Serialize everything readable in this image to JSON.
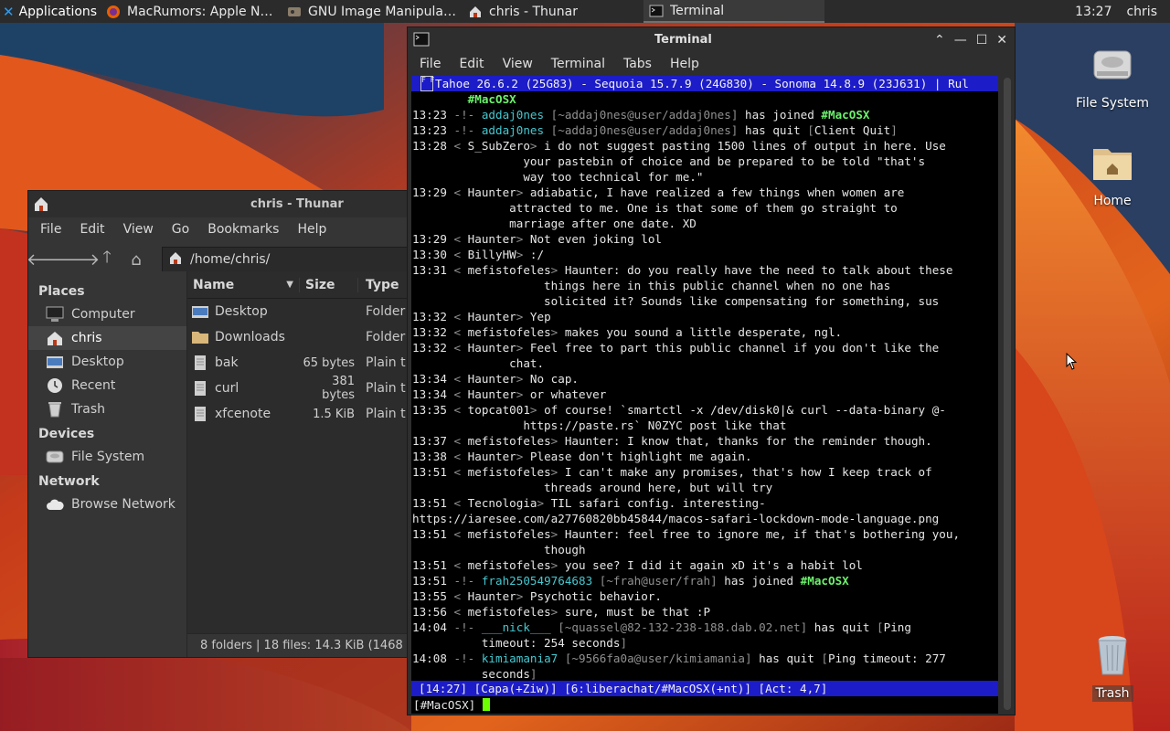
{
  "panel": {
    "applications_label": "Applications",
    "tasks": [
      {
        "title": "MacRumors: Apple New...",
        "icon": "firefox-icon"
      },
      {
        "title": "GNU Image Manipulatio...",
        "icon": "gimp-icon"
      },
      {
        "title": "chris - Thunar",
        "icon": "home-folder-icon"
      },
      {
        "title": "Terminal",
        "icon": "terminal-icon"
      }
    ],
    "clock": "13:27",
    "user": "chris"
  },
  "desktop": {
    "icons": [
      {
        "label": "File System",
        "icon": "drive-icon"
      },
      {
        "label": "Home",
        "icon": "home-folder-icon"
      },
      {
        "label": "Trash",
        "icon": "trash-icon"
      }
    ]
  },
  "thunar": {
    "title": "chris - Thunar",
    "menu": [
      "File",
      "Edit",
      "View",
      "Go",
      "Bookmarks",
      "Help"
    ],
    "path": "/home/chris/",
    "sidebar": {
      "places_heading": "Places",
      "places": [
        "Computer",
        "chris",
        "Desktop",
        "Recent",
        "Trash"
      ],
      "devices_heading": "Devices",
      "devices": [
        "File System"
      ],
      "network_heading": "Network",
      "network": [
        "Browse Network"
      ]
    },
    "columns": {
      "name": "Name",
      "size": "Size",
      "type": "Type"
    },
    "files": [
      {
        "name": "Desktop",
        "size": "",
        "type": "Folder"
      },
      {
        "name": "Downloads",
        "size": "",
        "type": "Folder"
      },
      {
        "name": "bak",
        "size": "65 bytes",
        "type": "Plain t"
      },
      {
        "name": "curl",
        "size": "381 bytes",
        "type": "Plain t"
      },
      {
        "name": "xfcenote",
        "size": "1.5 KiB",
        "type": "Plain t"
      }
    ],
    "status": "8 folders  |  18 files: 14.3 KiB (1468"
  },
  "terminal": {
    "title": "Terminal",
    "menu": [
      "File",
      "Edit",
      "View",
      "Terminal",
      "Tabs",
      "Help"
    ],
    "topic": "Tahoe 26.6.2 (25G83) - Sequoia 15.7.9 (24G830) - Sonoma 14.8.9 (23J631) | Rul",
    "lines": [
      [
        {
          "t": "        "
        },
        {
          "t": "#MacOSX",
          "c": "greenb"
        }
      ],
      [
        {
          "t": "13:23 "
        },
        {
          "t": "-!- ",
          "c": "dim"
        },
        {
          "t": "addaj0nes",
          "c": "cyan"
        },
        {
          "t": " [",
          "c": "dim"
        },
        {
          "t": "~addaj0nes@user/addaj0nes",
          "c": "dim"
        },
        {
          "t": "]",
          "c": "dim"
        },
        {
          "t": " has joined "
        },
        {
          "t": "#MacOSX",
          "c": "greenb"
        }
      ],
      [
        {
          "t": "13:23 "
        },
        {
          "t": "-!- ",
          "c": "dim"
        },
        {
          "t": "addaj0nes",
          "c": "cyan"
        },
        {
          "t": " [~addaj0nes@user/addaj0nes]",
          "c": "dim"
        },
        {
          "t": " has quit "
        },
        {
          "t": "[",
          "c": "dim"
        },
        {
          "t": "Client Quit"
        },
        {
          "t": "]",
          "c": "dim"
        }
      ],
      [
        {
          "t": "13:28 "
        },
        {
          "t": "< ",
          "c": "dim"
        },
        {
          "t": "S_SubZero"
        },
        {
          "t": "> ",
          "c": "dim"
        },
        {
          "t": "i do not suggest pasting 1500 lines of output in here. Use"
        }
      ],
      [
        {
          "t": "                your pastebin of choice and be prepared to be told \"that's"
        }
      ],
      [
        {
          "t": "                way too technical for me.\""
        }
      ],
      [
        {
          "t": "13:29 "
        },
        {
          "t": "< ",
          "c": "dim"
        },
        {
          "t": "Haunter"
        },
        {
          "t": "> ",
          "c": "dim"
        },
        {
          "t": "adiabatic, I have realized a few things when women are"
        }
      ],
      [
        {
          "t": "              attracted to me. One is that some of them go straight to"
        }
      ],
      [
        {
          "t": "              marriage after one date. XD"
        }
      ],
      [
        {
          "t": "13:29 "
        },
        {
          "t": "< ",
          "c": "dim"
        },
        {
          "t": "Haunter"
        },
        {
          "t": "> ",
          "c": "dim"
        },
        {
          "t": "Not even joking lol"
        }
      ],
      [
        {
          "t": "13:30 "
        },
        {
          "t": "< ",
          "c": "dim"
        },
        {
          "t": "BillyHW"
        },
        {
          "t": "> ",
          "c": "dim"
        },
        {
          "t": ":/"
        }
      ],
      [
        {
          "t": "13:31 "
        },
        {
          "t": "< ",
          "c": "dim"
        },
        {
          "t": "mefistofeles"
        },
        {
          "t": "> ",
          "c": "dim"
        },
        {
          "t": "Haunter: do you really have the need to talk about these"
        }
      ],
      [
        {
          "t": "                   things here in this public channel when no one has"
        }
      ],
      [
        {
          "t": "                   solicited it? Sounds like compensating for something, sus"
        }
      ],
      [
        {
          "t": "13:32 "
        },
        {
          "t": "< ",
          "c": "dim"
        },
        {
          "t": "Haunter"
        },
        {
          "t": "> ",
          "c": "dim"
        },
        {
          "t": "Yep"
        }
      ],
      [
        {
          "t": "13:32 "
        },
        {
          "t": "< ",
          "c": "dim"
        },
        {
          "t": "mefistofeles"
        },
        {
          "t": "> ",
          "c": "dim"
        },
        {
          "t": "makes you sound a little desperate, ngl."
        }
      ],
      [
        {
          "t": "13:32 "
        },
        {
          "t": "< ",
          "c": "dim"
        },
        {
          "t": "Haunter"
        },
        {
          "t": "> ",
          "c": "dim"
        },
        {
          "t": "Feel free to part this public channel if you don't like the"
        }
      ],
      [
        {
          "t": "              chat."
        }
      ],
      [
        {
          "t": "13:34 "
        },
        {
          "t": "< ",
          "c": "dim"
        },
        {
          "t": "Haunter"
        },
        {
          "t": "> ",
          "c": "dim"
        },
        {
          "t": "No cap."
        }
      ],
      [
        {
          "t": "13:34 "
        },
        {
          "t": "< ",
          "c": "dim"
        },
        {
          "t": "Haunter"
        },
        {
          "t": "> ",
          "c": "dim"
        },
        {
          "t": "or whatever"
        }
      ],
      [
        {
          "t": "13:35 "
        },
        {
          "t": "< ",
          "c": "dim"
        },
        {
          "t": "topcat001"
        },
        {
          "t": "> ",
          "c": "dim"
        },
        {
          "t": "of course! `smartctl -x /dev/disk0|& curl --data-binary @-"
        }
      ],
      [
        {
          "t": "                https://paste.rs` N0ZYC post like that"
        }
      ],
      [
        {
          "t": "13:37 "
        },
        {
          "t": "< ",
          "c": "dim"
        },
        {
          "t": "mefistofeles"
        },
        {
          "t": "> ",
          "c": "dim"
        },
        {
          "t": "Haunter: I know that, thanks for the reminder though."
        }
      ],
      [
        {
          "t": "13:38 "
        },
        {
          "t": "< ",
          "c": "dim"
        },
        {
          "t": "Haunter"
        },
        {
          "t": "> ",
          "c": "dim"
        },
        {
          "t": "Please don't highlight me again."
        }
      ],
      [
        {
          "t": "13:51 "
        },
        {
          "t": "< ",
          "c": "dim"
        },
        {
          "t": "mefistofeles"
        },
        {
          "t": "> ",
          "c": "dim"
        },
        {
          "t": "I can't make any promises, that's how I keep track of"
        }
      ],
      [
        {
          "t": "                   threads around here, but will try"
        }
      ],
      [
        {
          "t": "13:51 "
        },
        {
          "t": "< ",
          "c": "dim"
        },
        {
          "t": "Tecnologia"
        },
        {
          "t": "> ",
          "c": "dim"
        },
        {
          "t": "TIL safari config. interesting-"
        }
      ],
      [
        {
          "t": "https://iaresee.com/a27760820bb45844/macos-safari-lockdown-mode-language.png"
        }
      ],
      [
        {
          "t": "13:51 "
        },
        {
          "t": "< ",
          "c": "dim"
        },
        {
          "t": "mefistofeles"
        },
        {
          "t": "> ",
          "c": "dim"
        },
        {
          "t": "Haunter: feel free to ignore me, if that's bothering you,"
        }
      ],
      [
        {
          "t": "                   though"
        }
      ],
      [
        {
          "t": "13:51 "
        },
        {
          "t": "< ",
          "c": "dim"
        },
        {
          "t": "mefistofeles"
        },
        {
          "t": "> ",
          "c": "dim"
        },
        {
          "t": "you see? I did it again xD it's a habit lol"
        }
      ],
      [
        {
          "t": "13:51 "
        },
        {
          "t": "-!- ",
          "c": "dim"
        },
        {
          "t": "frah250549764683",
          "c": "cyan"
        },
        {
          "t": " [~frah@user/frah]",
          "c": "dim"
        },
        {
          "t": " has joined "
        },
        {
          "t": "#MacOSX",
          "c": "greenb"
        }
      ],
      [
        {
          "t": "13:55 "
        },
        {
          "t": "< ",
          "c": "dim"
        },
        {
          "t": "Haunter"
        },
        {
          "t": "> ",
          "c": "dim"
        },
        {
          "t": "Psychotic behavior."
        }
      ],
      [
        {
          "t": "13:56 "
        },
        {
          "t": "< ",
          "c": "dim"
        },
        {
          "t": "mefistofeles"
        },
        {
          "t": "> ",
          "c": "dim"
        },
        {
          "t": "sure, must be that :P"
        }
      ],
      [
        {
          "t": "14:04 "
        },
        {
          "t": "-!- ",
          "c": "dim"
        },
        {
          "t": "___nick___",
          "c": "cyan"
        },
        {
          "t": " [~quassel@82-132-238-188.dab.02.net]",
          "c": "dim"
        },
        {
          "t": " has quit "
        },
        {
          "t": "[",
          "c": "dim"
        },
        {
          "t": "Ping"
        }
      ],
      [
        {
          "t": "          timeout: 254 seconds"
        },
        {
          "t": "]",
          "c": "dim"
        }
      ],
      [
        {
          "t": "14:08 "
        },
        {
          "t": "-!- ",
          "c": "dim"
        },
        {
          "t": "kimiamania7",
          "c": "cyan"
        },
        {
          "t": " [~9566fa0a@user/kimiamania]",
          "c": "dim"
        },
        {
          "t": " has quit "
        },
        {
          "t": "[",
          "c": "dim"
        },
        {
          "t": "Ping timeout: 277"
        }
      ],
      [
        {
          "t": "          seconds"
        },
        {
          "t": "]",
          "c": "dim"
        }
      ]
    ],
    "status_bar": "[14:27] [Capa(+Ziw)] [6:liberachat/#MacOSX(+nt)] [Act: 4,7]",
    "prompt": "[#MacOSX] "
  }
}
